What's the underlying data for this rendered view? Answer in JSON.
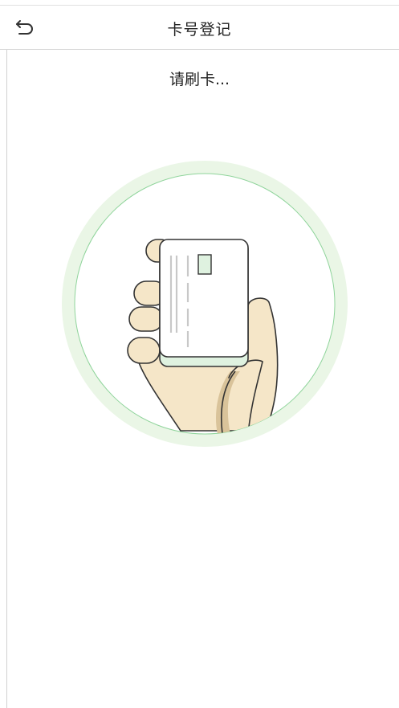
{
  "header": {
    "title": "卡号登记",
    "back_icon": "back-arrow-icon"
  },
  "main": {
    "prompt": "请刷卡...",
    "illustration_icon": "hand-holding-card-icon"
  },
  "colors": {
    "circle_outer": "#eaf6e6",
    "circle_line": "#8fd49b",
    "skin": "#f5e6c8",
    "card_accent": "#dff2e0",
    "outline": "#333333"
  }
}
